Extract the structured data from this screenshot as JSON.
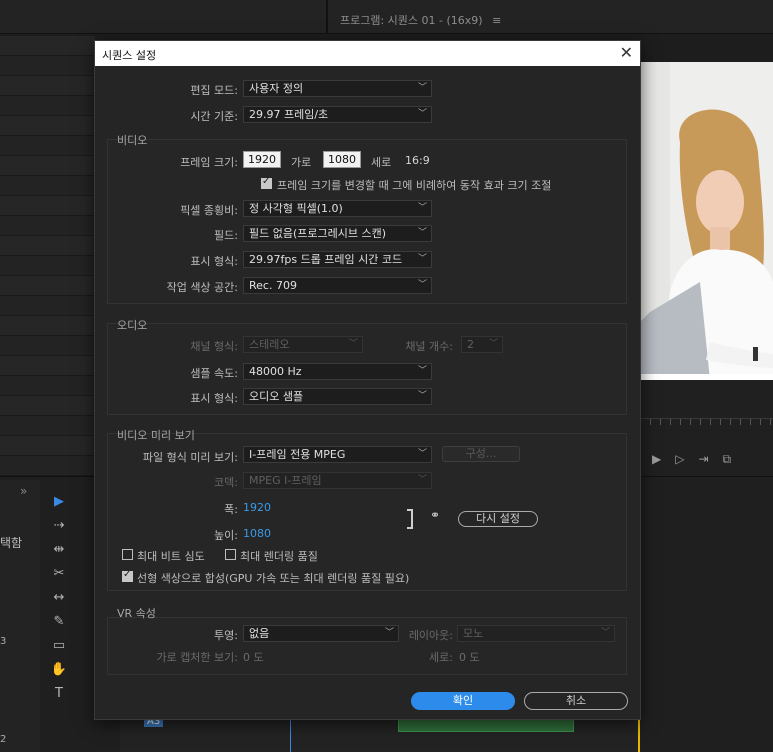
{
  "background": {
    "program_monitor_title": "프로그램: 시퀀스 01 - (16x9)",
    "panel_menu_glyph": "≡",
    "chevron": "»",
    "left_label": "택함",
    "left_numbers": [
      "3",
      "2"
    ],
    "track_label": "A3",
    "tools": [
      "selection-tool-icon",
      "track-select-icon",
      "ripple-edit-icon",
      "razor-icon",
      "slip-icon",
      "pen-icon",
      "rectangle-icon",
      "hand-icon",
      "type-icon"
    ],
    "tool_glyphs": [
      "▶",
      "⇢",
      "⇹",
      "✂",
      "↔",
      "✎",
      "▭",
      "✋",
      "T"
    ],
    "transport_glyphs": [
      "▶",
      "▷",
      "⇥",
      "⧉"
    ]
  },
  "dialog": {
    "title": "시퀀스 설정",
    "close": "✕",
    "edit_mode": {
      "label": "편집 모드:",
      "value": "사용자 정의"
    },
    "timebase": {
      "label": "시간 기준:",
      "value": "29.97  프레임/초"
    },
    "video": {
      "title": "비디오",
      "frame_size_label": "프레임 크기:",
      "width": "1920",
      "horizontal": "가로",
      "height": "1080",
      "vertical": "세로",
      "aspect": "16:9",
      "scale_checkbox": "프레임 크기를 변경할 때 그에 비례하여 동작 효과 크기 조절",
      "pixel_aspect_label": "픽셀 종횡비:",
      "pixel_aspect_value": "정 사각형 픽셀(1.0)",
      "fields_label": "필드:",
      "fields_value": "필드 없음(프로그레시브 스캔)",
      "display_format_label": "표시 형식:",
      "display_format_value": "29.97fps 드롭 프레임 시간 코드",
      "color_space_label": "작업 색상 공간:",
      "color_space_value": "Rec. 709"
    },
    "audio": {
      "title": "오디오",
      "channel_format_label": "채널 형식:",
      "channel_format_value": "스테레오",
      "channel_count_label": "채널 개수:",
      "channel_count_value": "2",
      "sample_rate_label": "샘플 속도:",
      "sample_rate_value": "48000 Hz",
      "display_format_label": "표시 형식:",
      "display_format_value": "오디오 샘플"
    },
    "preview": {
      "title": "비디오 미리 보기",
      "file_format_label": "파일 형식 미리 보기:",
      "file_format_value": "I-프레임 전용 MPEG",
      "configure_button": "구성...",
      "codec_label": "코덱:",
      "codec_value": "MPEG I-프레임",
      "width_label": "폭:",
      "width_value": "1920",
      "height_label": "높이:",
      "height_value": "1080",
      "reset_button": "다시 설정",
      "max_bit_depth": "최대 비트 심도",
      "max_render_quality": "최대 렌더링 품질",
      "linear_color": "선형 색상으로 합성(GPU 가속 또는 최대 렌더링 품질 필요)"
    },
    "vr": {
      "title": "VR 속성",
      "projection_label": "투영:",
      "projection_value": "없음",
      "layout_label": "레이아웃:",
      "layout_value": "모노",
      "horizontal_label": "가로 캡처한 보기:",
      "horizontal_value": "0 도",
      "vertical_label": "세로:",
      "vertical_value": "0 도"
    },
    "ok_button": "확인",
    "cancel_button": "취소"
  }
}
